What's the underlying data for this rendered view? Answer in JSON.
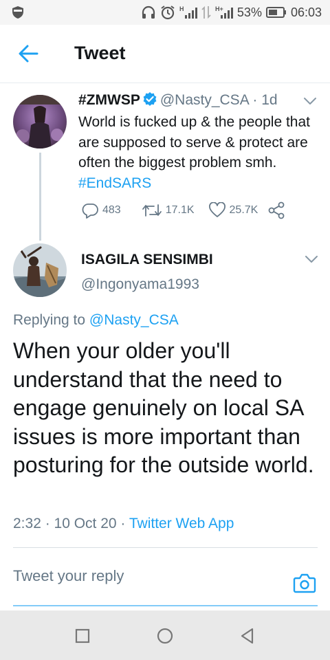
{
  "status_bar": {
    "battery": "53%",
    "time": "06:03"
  },
  "header": {
    "title": "Tweet"
  },
  "original_tweet": {
    "display_name": "#ZMWSP",
    "handle": "@Nasty_CSA",
    "time_ago": "· 1d",
    "text": "World is fucked up & the people that are supposed to serve & protect are often the biggest problem smh.",
    "hashtag": "#EndSARS",
    "replies": "483",
    "retweets": "17.1K",
    "likes": "25.7K"
  },
  "reply_tweet": {
    "display_name": "ISAGILA SENSIMBI",
    "handle": "@Ingonyama1993",
    "replying_to_label": "Replying to ",
    "replying_to_handle": "@Nasty_CSA",
    "text": "When your older you'll understand that the need to engage genuinely on local SA issues is more important than posturing for the outside world.",
    "timestamp": "2:32 · 10 Oct 20 · ",
    "source": "Twitter Web App"
  },
  "reply_box": {
    "placeholder": "Tweet your reply"
  },
  "colors": {
    "accent": "#1da1f2",
    "secondary_text": "#657786",
    "primary_text": "#14171a"
  }
}
